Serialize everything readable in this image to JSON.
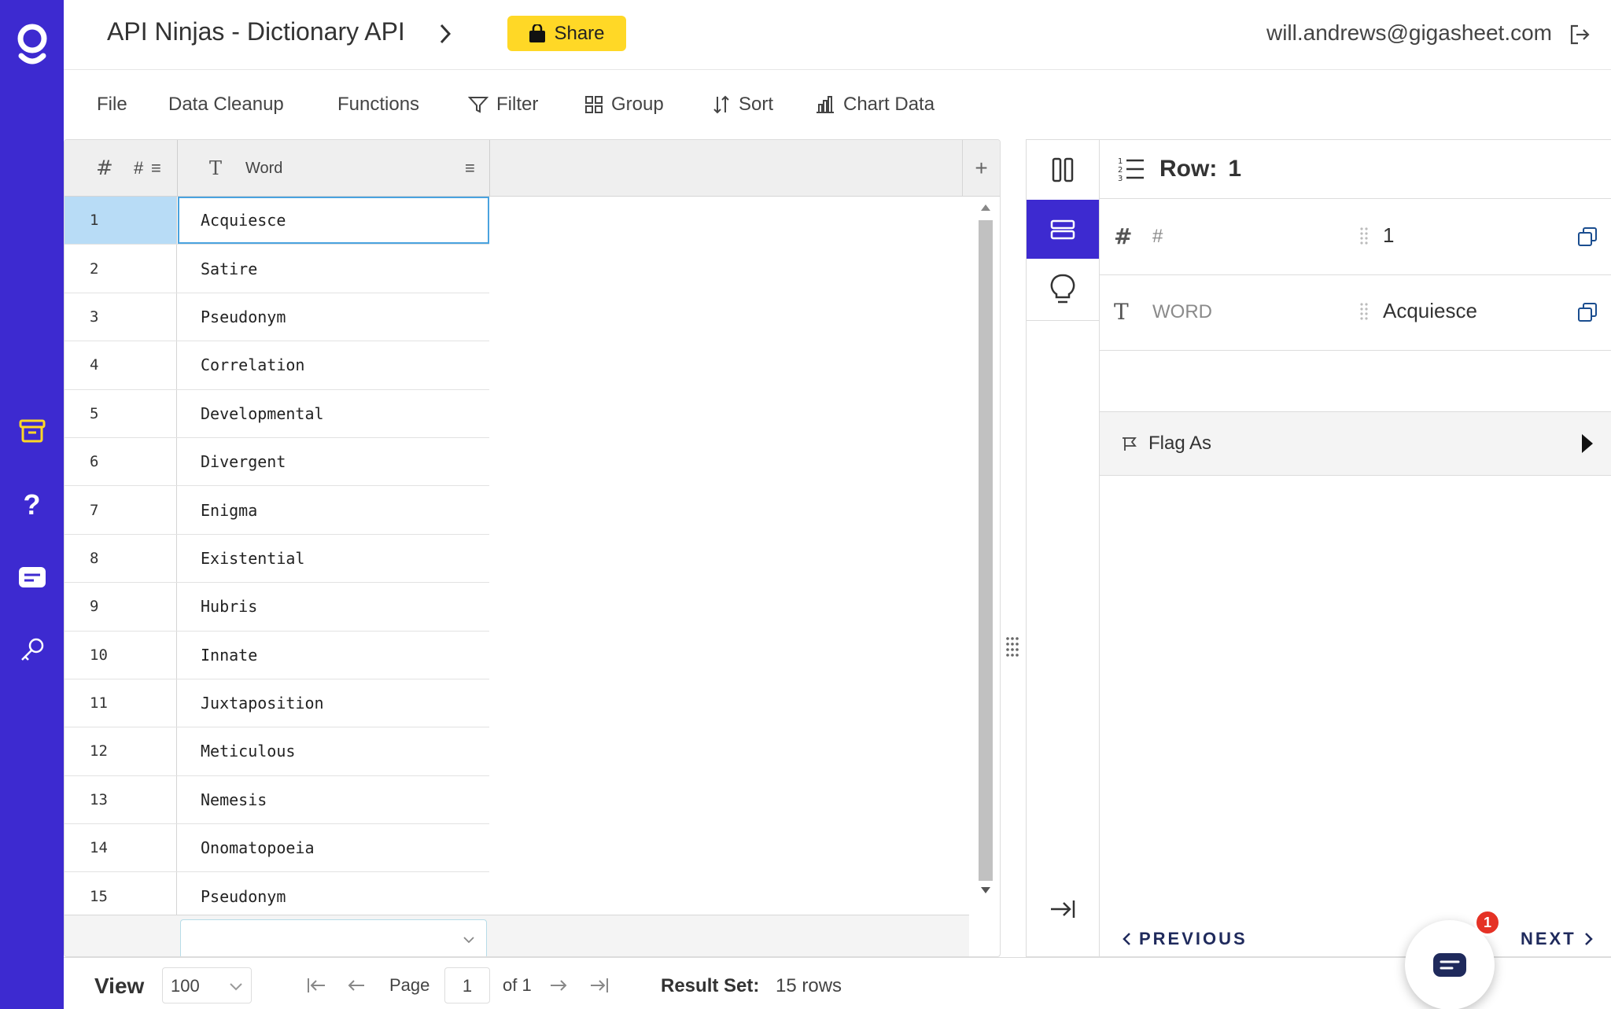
{
  "header": {
    "title": "API Ninjas - Dictionary API",
    "share_label": "Share",
    "user_email": "will.andrews@gigasheet.com"
  },
  "toolbar": {
    "file": "File",
    "data_cleanup": "Data Cleanup",
    "functions": "Functions",
    "filter": "Filter",
    "group": "Group",
    "sort": "Sort",
    "chart_data": "Chart Data"
  },
  "grid": {
    "columns": [
      {
        "type_icon": "hash-icon",
        "label": "#"
      },
      {
        "type_icon": "text-type-icon",
        "label": "Word"
      }
    ],
    "add_column_label": "+",
    "rows": [
      {
        "num": "1",
        "word": "Acquiesce"
      },
      {
        "num": "2",
        "word": "Satire"
      },
      {
        "num": "3",
        "word": "Pseudonym"
      },
      {
        "num": "4",
        "word": "Correlation"
      },
      {
        "num": "5",
        "word": "Developmental"
      },
      {
        "num": "6",
        "word": "Divergent"
      },
      {
        "num": "7",
        "word": "Enigma"
      },
      {
        "num": "8",
        "word": "Existential"
      },
      {
        "num": "9",
        "word": "Hubris"
      },
      {
        "num": "10",
        "word": "Innate"
      },
      {
        "num": "11",
        "word": "Juxtaposition"
      },
      {
        "num": "12",
        "word": "Meticulous"
      },
      {
        "num": "13",
        "word": "Nemesis"
      },
      {
        "num": "14",
        "word": "Onomatopoeia"
      },
      {
        "num": "15",
        "word": "Pseudonym"
      }
    ],
    "selected_row": 1
  },
  "row_panel": {
    "row_label": "Row:",
    "row_number": "1",
    "fields": [
      {
        "type_icon": "hash-icon",
        "type_glyph": "#",
        "name": "#",
        "value": "1"
      },
      {
        "type_icon": "text-type-icon",
        "type_glyph": "T",
        "name": "WORD",
        "value": "Acquiesce"
      }
    ],
    "flag_as": "Flag As",
    "previous": "PREVIOUS",
    "next": "NEXT"
  },
  "bottom_bar": {
    "view_label": "View",
    "view_value": "100",
    "page_label": "Page",
    "page_value": "1",
    "of_label": "of 1",
    "result_label": "Result Set:",
    "result_value": "15 rows"
  },
  "chat": {
    "badge_count": "1"
  },
  "colors": {
    "brand": "#3d2ad0",
    "share": "#ffd826",
    "selection": "#b8dcf6",
    "badge": "#e53225"
  }
}
